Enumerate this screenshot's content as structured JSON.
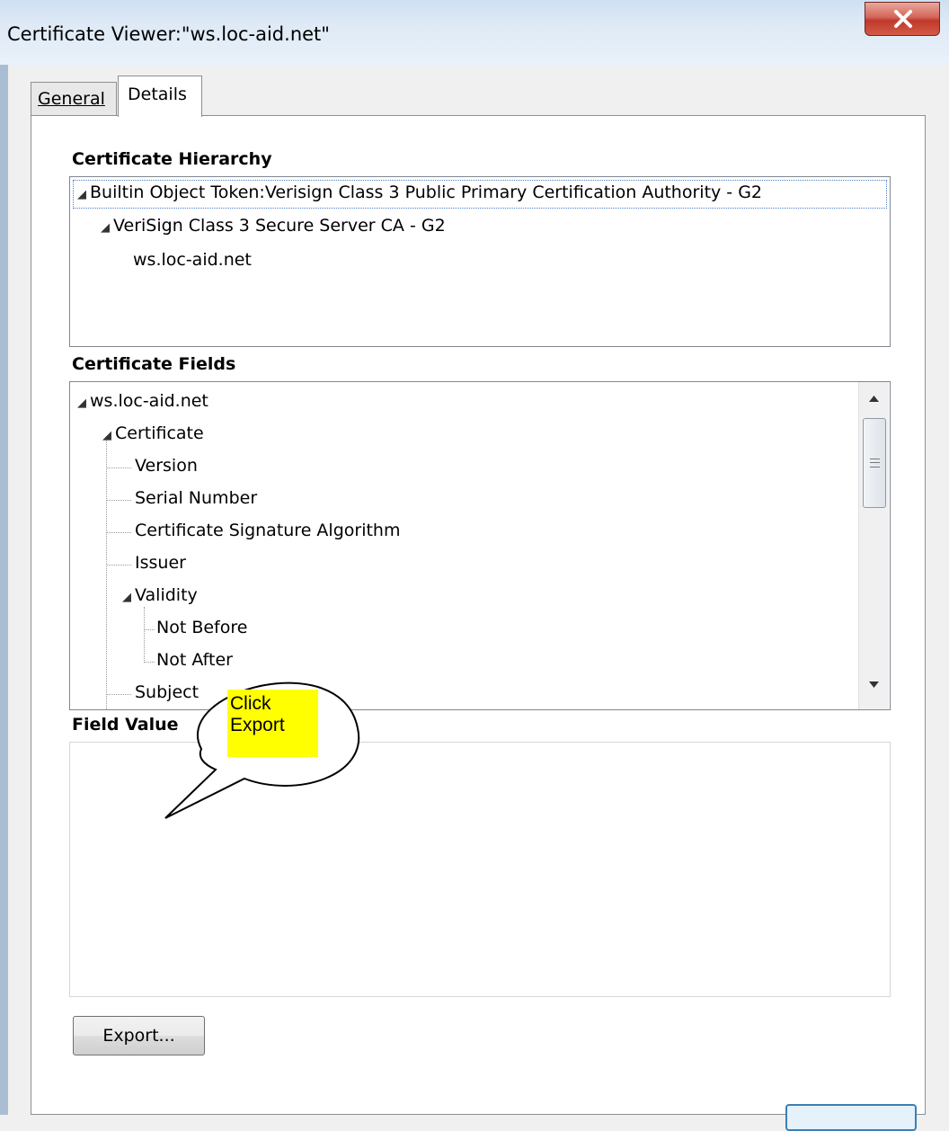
{
  "window": {
    "title": "Certificate Viewer:\"ws.loc-aid.net\"",
    "close_glyph": "X"
  },
  "tabs": [
    {
      "label": "General",
      "selected": false
    },
    {
      "label": "Details",
      "selected": true
    }
  ],
  "hierarchy": {
    "label": "Certificate Hierarchy",
    "items": [
      {
        "text": "Builtin Object Token:Verisign Class 3 Public Primary Certification Authority - G2",
        "expanded": true
      },
      {
        "text": "VeriSign Class 3 Secure Server CA - G2",
        "expanded": true
      },
      {
        "text": "ws.loc-aid.net",
        "expanded": null
      }
    ]
  },
  "fields": {
    "label": "Certificate Fields",
    "items": [
      {
        "text": "ws.loc-aid.net"
      },
      {
        "text": "Certificate"
      },
      {
        "text": "Version"
      },
      {
        "text": "Serial Number"
      },
      {
        "text": "Certificate Signature Algorithm"
      },
      {
        "text": "Issuer"
      },
      {
        "text": "Validity"
      },
      {
        "text": "Not Before"
      },
      {
        "text": "Not After"
      },
      {
        "text": "Subject"
      }
    ]
  },
  "field_value": {
    "label": "Field Value",
    "value": ""
  },
  "export_button": {
    "label": "Export..."
  },
  "callout": {
    "line1": "Click",
    "line2": "Export"
  },
  "colors": {
    "callout_highlight": "#ffff00",
    "close_button": "#c0392b",
    "titlebar": "#dfeaf6"
  }
}
